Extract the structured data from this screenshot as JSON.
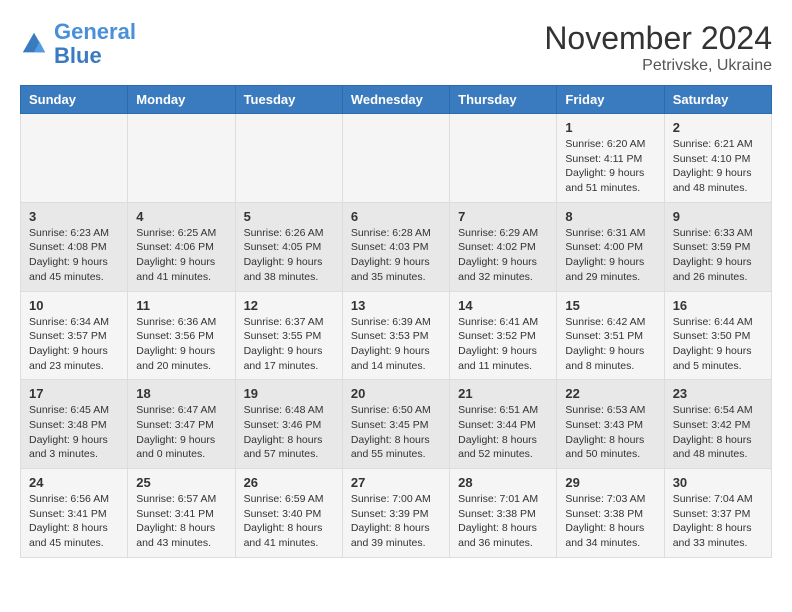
{
  "header": {
    "logo_line1": "General",
    "logo_line2": "Blue",
    "month": "November 2024",
    "location": "Petrivske, Ukraine"
  },
  "days_of_week": [
    "Sunday",
    "Monday",
    "Tuesday",
    "Wednesday",
    "Thursday",
    "Friday",
    "Saturday"
  ],
  "weeks": [
    [
      {
        "day": "",
        "info": ""
      },
      {
        "day": "",
        "info": ""
      },
      {
        "day": "",
        "info": ""
      },
      {
        "day": "",
        "info": ""
      },
      {
        "day": "",
        "info": ""
      },
      {
        "day": "1",
        "info": "Sunrise: 6:20 AM\nSunset: 4:11 PM\nDaylight: 9 hours and 51 minutes."
      },
      {
        "day": "2",
        "info": "Sunrise: 6:21 AM\nSunset: 4:10 PM\nDaylight: 9 hours and 48 minutes."
      }
    ],
    [
      {
        "day": "3",
        "info": "Sunrise: 6:23 AM\nSunset: 4:08 PM\nDaylight: 9 hours and 45 minutes."
      },
      {
        "day": "4",
        "info": "Sunrise: 6:25 AM\nSunset: 4:06 PM\nDaylight: 9 hours and 41 minutes."
      },
      {
        "day": "5",
        "info": "Sunrise: 6:26 AM\nSunset: 4:05 PM\nDaylight: 9 hours and 38 minutes."
      },
      {
        "day": "6",
        "info": "Sunrise: 6:28 AM\nSunset: 4:03 PM\nDaylight: 9 hours and 35 minutes."
      },
      {
        "day": "7",
        "info": "Sunrise: 6:29 AM\nSunset: 4:02 PM\nDaylight: 9 hours and 32 minutes."
      },
      {
        "day": "8",
        "info": "Sunrise: 6:31 AM\nSunset: 4:00 PM\nDaylight: 9 hours and 29 minutes."
      },
      {
        "day": "9",
        "info": "Sunrise: 6:33 AM\nSunset: 3:59 PM\nDaylight: 9 hours and 26 minutes."
      }
    ],
    [
      {
        "day": "10",
        "info": "Sunrise: 6:34 AM\nSunset: 3:57 PM\nDaylight: 9 hours and 23 minutes."
      },
      {
        "day": "11",
        "info": "Sunrise: 6:36 AM\nSunset: 3:56 PM\nDaylight: 9 hours and 20 minutes."
      },
      {
        "day": "12",
        "info": "Sunrise: 6:37 AM\nSunset: 3:55 PM\nDaylight: 9 hours and 17 minutes."
      },
      {
        "day": "13",
        "info": "Sunrise: 6:39 AM\nSunset: 3:53 PM\nDaylight: 9 hours and 14 minutes."
      },
      {
        "day": "14",
        "info": "Sunrise: 6:41 AM\nSunset: 3:52 PM\nDaylight: 9 hours and 11 minutes."
      },
      {
        "day": "15",
        "info": "Sunrise: 6:42 AM\nSunset: 3:51 PM\nDaylight: 9 hours and 8 minutes."
      },
      {
        "day": "16",
        "info": "Sunrise: 6:44 AM\nSunset: 3:50 PM\nDaylight: 9 hours and 5 minutes."
      }
    ],
    [
      {
        "day": "17",
        "info": "Sunrise: 6:45 AM\nSunset: 3:48 PM\nDaylight: 9 hours and 3 minutes."
      },
      {
        "day": "18",
        "info": "Sunrise: 6:47 AM\nSunset: 3:47 PM\nDaylight: 9 hours and 0 minutes."
      },
      {
        "day": "19",
        "info": "Sunrise: 6:48 AM\nSunset: 3:46 PM\nDaylight: 8 hours and 57 minutes."
      },
      {
        "day": "20",
        "info": "Sunrise: 6:50 AM\nSunset: 3:45 PM\nDaylight: 8 hours and 55 minutes."
      },
      {
        "day": "21",
        "info": "Sunrise: 6:51 AM\nSunset: 3:44 PM\nDaylight: 8 hours and 52 minutes."
      },
      {
        "day": "22",
        "info": "Sunrise: 6:53 AM\nSunset: 3:43 PM\nDaylight: 8 hours and 50 minutes."
      },
      {
        "day": "23",
        "info": "Sunrise: 6:54 AM\nSunset: 3:42 PM\nDaylight: 8 hours and 48 minutes."
      }
    ],
    [
      {
        "day": "24",
        "info": "Sunrise: 6:56 AM\nSunset: 3:41 PM\nDaylight: 8 hours and 45 minutes."
      },
      {
        "day": "25",
        "info": "Sunrise: 6:57 AM\nSunset: 3:41 PM\nDaylight: 8 hours and 43 minutes."
      },
      {
        "day": "26",
        "info": "Sunrise: 6:59 AM\nSunset: 3:40 PM\nDaylight: 8 hours and 41 minutes."
      },
      {
        "day": "27",
        "info": "Sunrise: 7:00 AM\nSunset: 3:39 PM\nDaylight: 8 hours and 39 minutes."
      },
      {
        "day": "28",
        "info": "Sunrise: 7:01 AM\nSunset: 3:38 PM\nDaylight: 8 hours and 36 minutes."
      },
      {
        "day": "29",
        "info": "Sunrise: 7:03 AM\nSunset: 3:38 PM\nDaylight: 8 hours and 34 minutes."
      },
      {
        "day": "30",
        "info": "Sunrise: 7:04 AM\nSunset: 3:37 PM\nDaylight: 8 hours and 33 minutes."
      }
    ]
  ]
}
